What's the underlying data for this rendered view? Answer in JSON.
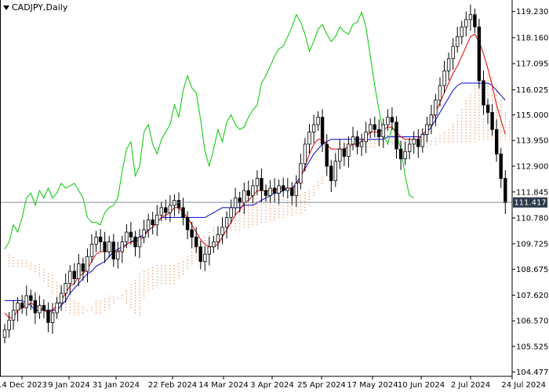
{
  "symbol": "CADJPY,Daily",
  "current_price_label": "111.417",
  "chart_data": {
    "type": "candlestick",
    "title": "CADJPY,Daily",
    "xlabel": "",
    "ylabel": "",
    "ylim": [
      104.3,
      119.7
    ],
    "grid": false,
    "yticks": [
      "119.230",
      "118.160",
      "117.095",
      "116.025",
      "115.000",
      "113.950",
      "112.900",
      "111.845",
      "110.780",
      "109.725",
      "108.675",
      "107.620",
      "106.570",
      "105.525",
      "104.477"
    ],
    "xticks": [
      "14 Dec 2023",
      "9 Jan 2024",
      "31 Jan 2024",
      "22 Feb 2024",
      "14 Mar 2024",
      "3 Apr 2024",
      "25 Apr 2024",
      "17 May 2024",
      "10 Jun 2024",
      "2 Jul 2024",
      "24 Jul 2024"
    ],
    "last_price": 111.417,
    "colors": {
      "candle": "#000000",
      "tenkan": "#e00000",
      "kijun": "#0000d0",
      "chikou": "#00c800",
      "cloud": "#e8905a",
      "price_line": "#7f8c96"
    },
    "series": [
      {
        "name": "Candles (close)",
        "values": [
          106.2,
          106.6,
          107.0,
          107.3,
          107.1,
          107.6,
          107.4,
          106.9,
          107.2,
          107.0,
          106.5,
          106.9,
          107.3,
          107.7,
          108.1,
          108.6,
          108.3,
          108.9,
          108.6,
          109.2,
          109.7,
          110.0,
          109.8,
          109.4,
          109.8,
          109.1,
          109.4,
          109.8,
          110.2,
          110.0,
          109.6,
          110.0,
          110.3,
          110.7,
          110.5,
          110.9,
          111.2,
          111.0,
          111.3,
          111.5,
          111.2,
          110.8,
          110.3,
          110.0,
          109.6,
          109.0,
          109.3,
          109.6,
          109.8,
          110.1,
          110.4,
          110.8,
          111.2,
          111.6,
          111.4,
          111.9,
          111.7,
          112.1,
          112.4,
          111.9,
          111.7,
          112.0,
          111.8,
          112.1,
          111.9,
          112.0,
          111.7,
          112.2,
          113.0,
          113.8,
          114.3,
          114.6,
          114.9,
          113.8,
          112.9,
          112.3,
          113.1,
          113.6,
          113.3,
          113.8,
          114.1,
          113.7,
          113.9,
          114.3,
          114.6,
          114.4,
          114.1,
          114.6,
          114.9,
          114.7,
          113.6,
          113.2,
          113.5,
          113.8,
          114.0,
          113.7,
          114.2,
          114.6,
          115.0,
          115.6,
          116.2,
          116.8,
          117.3,
          117.8,
          118.2,
          118.6,
          118.9,
          119.1,
          118.6,
          116.4,
          115.4,
          115.1,
          114.4,
          113.4,
          112.4,
          111.4
        ]
      },
      {
        "name": "Tenkan-sen",
        "values": [
          106.9,
          106.7,
          106.7,
          107.0,
          107.1,
          107.2,
          107.3,
          107.2,
          107.1,
          107.0,
          106.9,
          107.0,
          107.2,
          107.4,
          107.7,
          108.0,
          108.1,
          108.4,
          108.5,
          108.7,
          109.0,
          109.3,
          109.4,
          109.4,
          109.4,
          109.4,
          109.4,
          109.5,
          109.7,
          109.8,
          109.8,
          109.9,
          110.0,
          110.3,
          110.4,
          110.6,
          110.8,
          110.9,
          111.0,
          111.2,
          111.2,
          111.0,
          110.8,
          110.5,
          110.2,
          109.9,
          109.7,
          109.6,
          109.6,
          109.7,
          110.0,
          110.3,
          110.6,
          110.9,
          111.1,
          111.4,
          111.5,
          111.7,
          111.9,
          111.9,
          111.9,
          111.9,
          111.9,
          112.0,
          112.0,
          112.0,
          112.0,
          112.1,
          112.4,
          112.9,
          113.4,
          113.8,
          114.0,
          114.0,
          113.8,
          113.6,
          113.6,
          113.6,
          113.6,
          113.7,
          113.8,
          113.8,
          113.9,
          114.1,
          114.3,
          114.3,
          114.3,
          114.4,
          114.5,
          114.5,
          114.3,
          114.1,
          114.0,
          114.0,
          114.0,
          114.0,
          114.2,
          114.4,
          114.7,
          115.1,
          115.5,
          115.9,
          116.3,
          116.7,
          117.0,
          117.4,
          117.8,
          118.2,
          118.3,
          118.0,
          117.5,
          116.9,
          116.2,
          115.4,
          114.8,
          114.2
        ]
      },
      {
        "name": "Kijun-sen",
        "values": [
          107.4,
          107.4,
          107.4,
          107.4,
          107.4,
          107.3,
          107.2,
          107.0,
          107.0,
          107.0,
          107.0,
          107.0,
          107.0,
          107.2,
          107.4,
          107.7,
          107.9,
          108.1,
          108.3,
          108.5,
          108.6,
          108.8,
          108.9,
          109.0,
          109.2,
          109.4,
          109.5,
          109.6,
          109.7,
          109.8,
          109.9,
          110.0,
          110.1,
          110.3,
          110.4,
          110.6,
          110.8,
          110.8,
          110.8,
          110.8,
          110.8,
          110.8,
          110.8,
          110.8,
          110.8,
          110.8,
          110.8,
          110.9,
          111.0,
          111.1,
          111.2,
          111.2,
          111.2,
          111.2,
          111.2,
          111.3,
          111.3,
          111.3,
          111.4,
          111.5,
          111.6,
          111.7,
          111.8,
          111.8,
          111.9,
          112.0,
          112.0,
          112.2,
          112.5,
          112.8,
          113.1,
          113.4,
          113.6,
          113.8,
          113.9,
          114.0,
          114.0,
          114.0,
          114.0,
          114.0,
          114.0,
          114.0,
          114.0,
          114.0,
          114.0,
          114.0,
          114.0,
          114.0,
          114.1,
          114.1,
          114.1,
          114.1,
          114.1,
          114.1,
          114.1,
          114.1,
          114.1,
          114.3,
          114.5,
          114.8,
          115.1,
          115.4,
          115.7,
          116.0,
          116.2,
          116.3,
          116.3,
          116.3,
          116.3,
          116.3,
          116.3,
          116.3,
          116.2,
          116.0,
          115.8,
          115.6
        ]
      },
      {
        "name": "Chikou Span",
        "values": [
          109.5,
          109.8,
          110.5,
          110.2,
          110.8,
          111.6,
          111.8,
          111.3,
          111.9,
          111.6,
          112.0,
          111.6,
          111.8,
          112.2,
          112.0,
          112.1,
          112.2,
          111.9,
          111.6,
          110.8,
          110.6,
          110.6,
          110.5,
          111.0,
          111.2,
          111.3,
          111.6,
          112.7,
          113.6,
          113.9,
          112.5,
          112.9,
          114.3,
          114.6,
          113.8,
          113.4,
          114.0,
          114.3,
          114.6,
          115.4,
          114.9,
          116.0,
          116.6,
          116.1,
          115.9,
          114.8,
          113.5,
          112.9,
          113.6,
          114.4,
          113.9,
          114.7,
          115.0,
          114.6,
          114.4,
          114.5,
          114.9,
          115.2,
          115.4,
          116.3,
          116.6,
          117.0,
          117.4,
          117.7,
          117.8,
          118.2,
          118.6,
          119.1,
          118.8,
          118.3,
          117.6,
          118.0,
          118.5,
          118.7,
          118.3,
          118.0,
          118.2,
          118.6,
          118.4,
          118.3,
          118.7,
          118.8,
          119.2,
          118.6,
          117.4,
          116.2,
          115.2,
          114.2,
          113.8,
          114.5,
          114.2,
          113.6,
          112.5,
          111.7,
          111.6
        ]
      },
      {
        "name": "Senkou Span A",
        "values": [
          109.3,
          109.2,
          109.1,
          109.1,
          109.1,
          109.0,
          108.9,
          108.9,
          108.8,
          108.6,
          108.5,
          108.2,
          108.0,
          107.8,
          107.6,
          107.5,
          107.3,
          107.2,
          107.1,
          107.0,
          106.9,
          106.9,
          107.0,
          107.1,
          107.3,
          107.5,
          107.7,
          107.9,
          108.1,
          108.3,
          108.5,
          108.6,
          108.7,
          108.8,
          108.9,
          108.9,
          108.9,
          108.9,
          108.9,
          109.0,
          109.1,
          109.2,
          109.4,
          109.6,
          109.8,
          110.0,
          110.2,
          110.4,
          110.6,
          110.9,
          111.1,
          111.3,
          111.4,
          111.5,
          111.5,
          111.6,
          111.6,
          111.7,
          111.7,
          111.6,
          111.6,
          111.6,
          111.6,
          111.7,
          111.7,
          111.7,
          111.7,
          111.8,
          111.9,
          112.0,
          112.1,
          112.3,
          112.5,
          112.8,
          113.2,
          113.6,
          113.9,
          114.1,
          114.2,
          114.2,
          114.2,
          114.1,
          114.0,
          114.0,
          114.0,
          114.1,
          114.2,
          114.3,
          114.3,
          114.2,
          114.0,
          113.9,
          113.8,
          113.8,
          113.8,
          113.8,
          113.9,
          114.0,
          114.1,
          114.2,
          114.3,
          114.5,
          114.7,
          115.0,
          115.3,
          115.6,
          115.9,
          116.2,
          116.4,
          116.6,
          116.7,
          116.6,
          116.2,
          115.6,
          115.1,
          114.8
        ]
      },
      {
        "name": "Senkou Span B",
        "values": [
          108.8,
          108.8,
          108.8,
          108.8,
          108.8,
          108.7,
          108.6,
          108.4,
          108.2,
          108.0,
          107.7,
          107.4,
          107.2,
          107.0,
          106.9,
          106.8,
          106.8,
          106.9,
          107.0,
          107.2,
          107.4,
          107.5,
          107.6,
          107.6,
          107.6,
          107.6,
          107.5,
          107.3,
          107.1,
          106.9,
          106.8,
          107.5,
          107.8,
          107.9,
          108.0,
          108.1,
          108.1,
          108.1,
          108.1,
          108.3,
          108.5,
          108.7,
          108.9,
          109.1,
          109.3,
          109.5,
          109.7,
          109.9,
          110.0,
          110.1,
          110.2,
          110.3,
          110.3,
          110.3,
          110.4,
          110.4,
          110.5,
          110.5,
          110.6,
          110.6,
          110.7,
          110.7,
          110.8,
          110.8,
          110.9,
          110.9,
          111.0,
          111.0,
          111.1,
          111.3,
          111.7,
          112.0,
          112.2,
          112.5,
          112.8,
          113.0,
          113.3,
          113.5,
          113.6,
          113.7,
          113.7,
          113.7,
          113.7,
          113.7,
          113.7,
          113.8,
          113.8,
          113.8,
          113.8,
          113.8,
          113.7,
          113.7,
          113.7,
          113.7,
          113.7,
          113.7,
          113.7,
          113.8,
          113.8,
          113.9,
          113.9,
          113.9,
          113.9,
          113.9,
          113.9,
          113.9,
          113.9,
          113.9,
          114.0,
          114.0,
          114.0,
          114.0,
          114.0,
          114.0,
          114.0,
          114.0
        ]
      }
    ]
  }
}
